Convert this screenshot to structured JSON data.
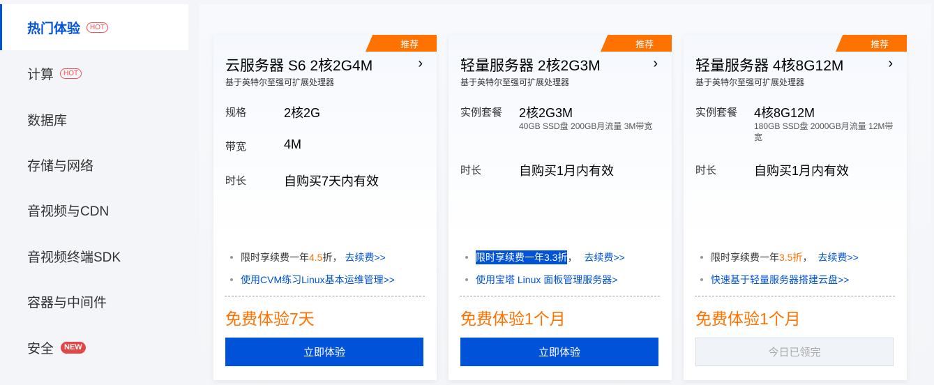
{
  "sidebar": {
    "items": [
      {
        "label": "热门体验",
        "badge": "HOT"
      },
      {
        "label": "计算",
        "badge": "HOT"
      },
      {
        "label": "数据库"
      },
      {
        "label": "存储与网络"
      },
      {
        "label": "音视频与CDN"
      },
      {
        "label": "音视频终端SDK"
      },
      {
        "label": "容器与中间件"
      },
      {
        "label": "安全",
        "badge": "NEW"
      }
    ]
  },
  "cards": [
    {
      "ribbon": "推荐",
      "title": "云服务器 S6 2核2G4M",
      "subtitle": "基于英特尔至强可扩展处理器",
      "specs": [
        {
          "label": "规格",
          "value": "2核2G"
        },
        {
          "label": "带宽",
          "value": "4M"
        },
        {
          "label": "时长",
          "value": "自购买7天内有效"
        }
      ],
      "offer_prefix": "限时享续费一年",
      "offer_price": "4.5",
      "offer_suffix": " 折，",
      "offer_link": "去续费>>",
      "guide_link": "使用CVM练习Linux基本运维管理>>",
      "promo": "免费体验7天",
      "button": "立即体验"
    },
    {
      "ribbon": "推荐",
      "title": "轻量服务器 2核2G3M",
      "subtitle": "基于英特尔至强可扩展处理器",
      "specs": [
        {
          "label": "实例套餐",
          "value": "2核2G3M",
          "note": "40GB SSD盘 200GB月流量 3M带宽"
        },
        {
          "label": "时长",
          "value": "自购买1月内有效"
        }
      ],
      "offer_highlight": "限时享续费一年3.3折",
      "offer_suffix": "，",
      "offer_link": "去续费>>",
      "guide_link": "使用宝塔 Linux 面板管理服务器>",
      "promo": "免费体验1个月",
      "button": "立即体验"
    },
    {
      "ribbon": "推荐",
      "title": "轻量服务器 4核8G12M",
      "subtitle": "基于英特尔至强可扩展处理器",
      "specs": [
        {
          "label": "实例套餐",
          "value": "4核8G12M",
          "note": "180GB SSD盘 2000GB月流量 12M带宽"
        },
        {
          "label": "时长",
          "value": "自购买1月内有效"
        }
      ],
      "offer_prefix": "限时享续费一年",
      "offer_price": "3.5折",
      "offer_suffix": "，",
      "offer_link": "去续费>>",
      "guide_link": "快速基于轻量服务器搭建云盘>>",
      "promo": "免费体验1个月",
      "button": "今日已领完"
    }
  ],
  "colors": {
    "accent": "#0052d9",
    "promo": "#ff7200",
    "hot": "#ff4d4f",
    "new": "#e54545"
  }
}
